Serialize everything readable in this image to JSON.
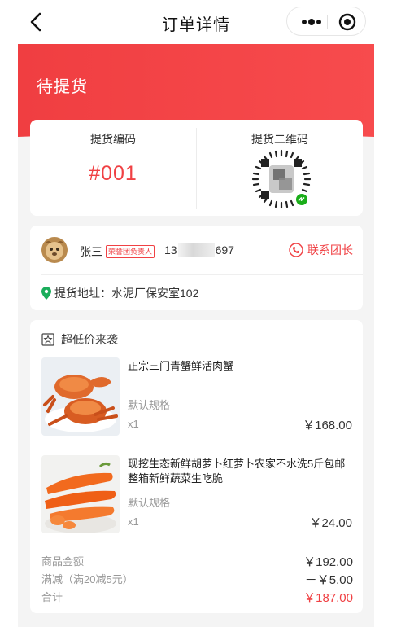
{
  "nav": {
    "title": "订单详情",
    "back_icon": "chevron-left-icon",
    "more_icon": "more-dots-icon",
    "record_icon": "record-circle-icon"
  },
  "banner": {
    "status": "待提货",
    "color": "#f03e41"
  },
  "pickup": {
    "code_label": "提货编码",
    "code": "#001",
    "qr_label": "提货二维码"
  },
  "leader": {
    "name": "张三",
    "tag": "荣誉团负责人",
    "phone_prefix": "13",
    "phone_suffix": "697",
    "contact_label": "联系团长",
    "address": "提货地址：水泥厂保安室102"
  },
  "order": {
    "section_title": "超低价来袭",
    "items": [
      {
        "name": "正宗三门青蟹鲜活肉蟹",
        "spec": "默认规格",
        "qty": "x1",
        "price": "￥168.00"
      },
      {
        "name": "现挖生态新鲜胡萝卜红萝卜农家不水洗5斤包邮整箱新鲜蔬菜生吃脆",
        "spec": "默认规格",
        "qty": "x1",
        "price": "￥24.00"
      }
    ],
    "summary": {
      "goods_label": "商品金额",
      "goods_value": "￥192.00",
      "discount_label": "满减（满20减5元）",
      "discount_value": "－￥5.00",
      "total_label": "合计",
      "total_value": "￥187.00"
    }
  },
  "colors": {
    "accent": "#f04144",
    "page_bg": "#f4f4f4"
  }
}
